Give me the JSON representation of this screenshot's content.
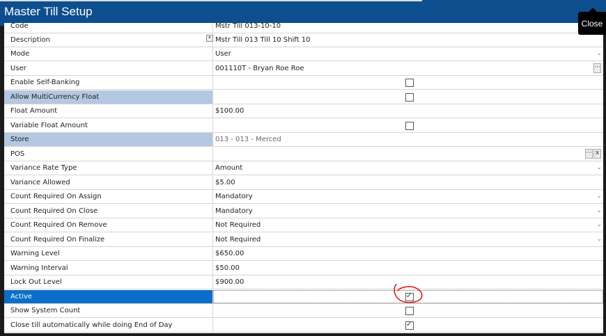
{
  "window": {
    "title": "Master Till Setup",
    "close_label": "Close"
  },
  "fields": {
    "code": {
      "label": "Code",
      "value": "Mstr Till 013-10-10"
    },
    "description": {
      "label": "Description",
      "value": "Mstr Till 013 Till 10 Shift 10"
    },
    "mode": {
      "label": "Mode",
      "value": "User"
    },
    "user": {
      "label": "User",
      "value": "001110T - Bryan Roe Roe"
    },
    "enable_self_banking": {
      "label": "Enable Self-Banking",
      "checked": false
    },
    "allow_multicurrency_float": {
      "label": "Allow MultiCurrency Float",
      "checked": false
    },
    "float_amount": {
      "label": "Float Amount",
      "value": "$100.00"
    },
    "variable_float_amount": {
      "label": "Variable Float Amount",
      "checked": false
    },
    "store": {
      "label": "Store",
      "value": "013 - 013 - Merced"
    },
    "pos": {
      "label": "POS",
      "value": ""
    },
    "variance_rate_type": {
      "label": "Variance Rate Type",
      "value": "Amount"
    },
    "variance_allowed": {
      "label": "Variance Allowed",
      "value": "$5.00"
    },
    "count_required_on_assign": {
      "label": "Count Required On Assign",
      "value": "Mandatory"
    },
    "count_required_on_close": {
      "label": "Count Required On Close",
      "value": "Mandatory"
    },
    "count_required_on_remove": {
      "label": "Count Required On Remove",
      "value": "Not Required"
    },
    "count_required_on_finalize": {
      "label": "Count Required On Finalize",
      "value": "Not Required"
    },
    "warning_level": {
      "label": "Warning Level",
      "value": "$650.00"
    },
    "warning_interval": {
      "label": "Warning Interval",
      "value": "$50.00"
    },
    "lock_out_level": {
      "label": "Lock Out Level",
      "value": "$900.00"
    },
    "active": {
      "label": "Active",
      "checked": true
    },
    "show_system_count": {
      "label": "Show System Count",
      "checked": false
    },
    "close_till_auto": {
      "label": "Close till automatically while doing End of Day",
      "checked": true
    }
  },
  "icons": {
    "browse": "ellipsis-icon",
    "clear": "x-icon",
    "dropdown": "chevron-down-icon",
    "edit": "edit-icon"
  },
  "colors": {
    "title_bar": "#0d4f8e",
    "selected_row": "#0b6fc9",
    "highlighted_row": "#b4c8e1",
    "annotation": "#e01010"
  }
}
